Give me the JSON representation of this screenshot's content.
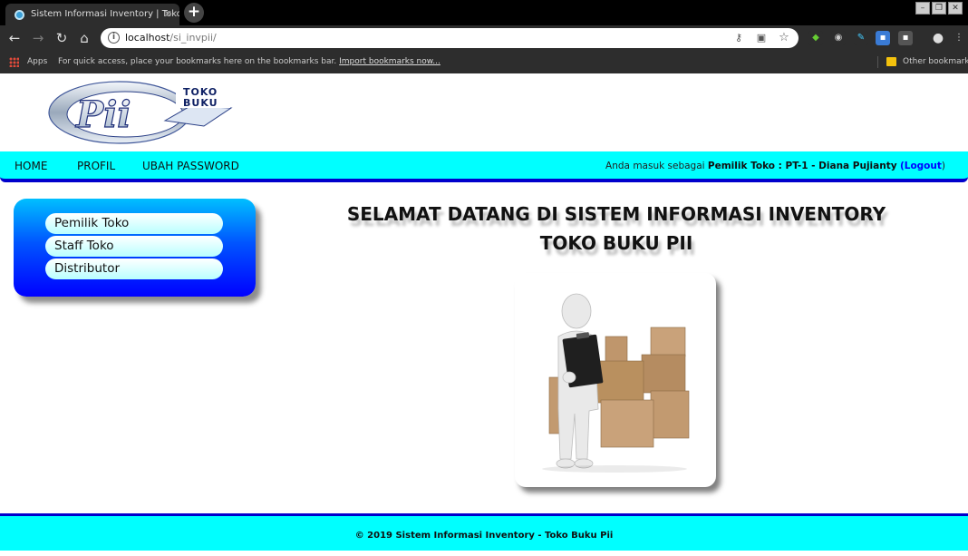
{
  "browser": {
    "tab_title": "Sistem Informasi Inventory | Toko",
    "url_host": "localhost",
    "url_path": "/si_invpii/",
    "apps_label": "Apps",
    "bookmarks_hint": "For quick access, place your bookmarks here on the bookmarks bar.",
    "import_link": "Import bookmarks now...",
    "other_bookmarks": "Other bookmarks"
  },
  "site": {
    "logo_text_main": "Pii",
    "logo_text_top": "TOKO",
    "logo_text_bottom": "BUKU"
  },
  "nav": {
    "items": [
      {
        "label": "HOME"
      },
      {
        "label": "PROFIL"
      },
      {
        "label": "UBAH PASSWORD"
      }
    ],
    "user": {
      "prefix": "Anda masuk sebagai",
      "role": "Pemilik Toko : PT-1 - Diana Pujianty",
      "open": "(",
      "logout": "Logout",
      "close": ")"
    }
  },
  "sidebar": {
    "items": [
      {
        "label": "Pemilik Toko"
      },
      {
        "label": "Staff Toko"
      },
      {
        "label": "Distributor"
      }
    ]
  },
  "main": {
    "title_line1": "SELAMAT DATANG DI SISTEM INFORMASI INVENTORY",
    "title_line2": "TOKO BUKU PII"
  },
  "footer": {
    "copyright": "© 2019 Sistem Informasi Inventory - Toko Buku Pii"
  },
  "colors": {
    "nav_bg": "#00ffff",
    "nav_border": "#0000cc",
    "sidebar_gradient_top": "#00bfff",
    "sidebar_gradient_bottom": "#0000ff",
    "link": "#0000ff"
  }
}
